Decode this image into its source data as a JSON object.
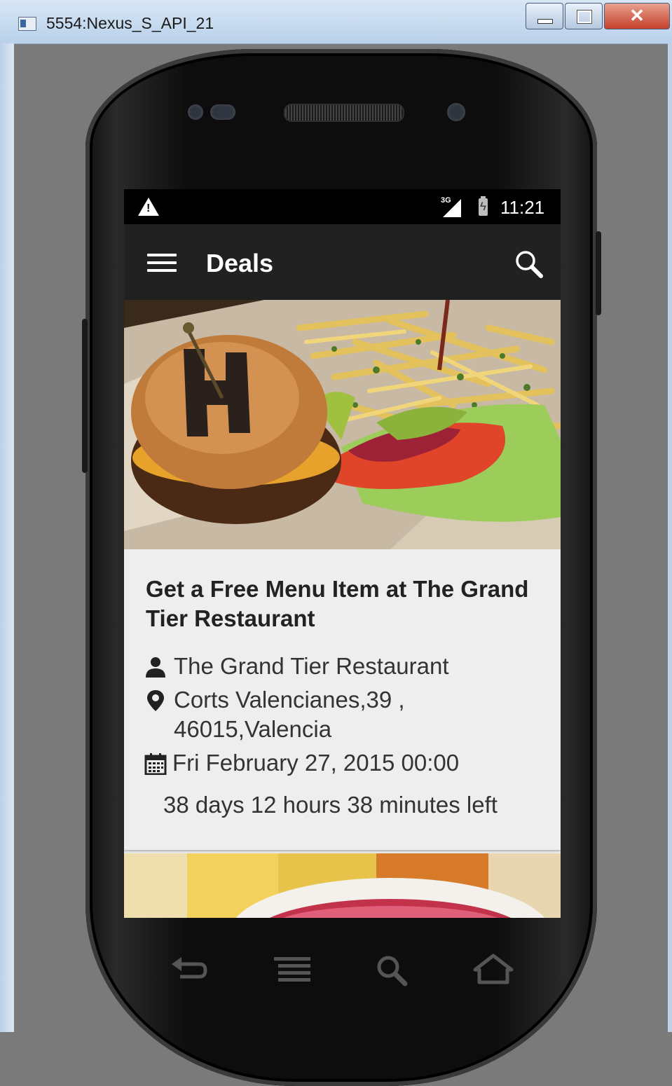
{
  "window": {
    "title": "5554:Nexus_S_API_21",
    "close_glyph": "✕"
  },
  "status_bar": {
    "network": "3G",
    "time": "11:21",
    "warning_icon": "warning-icon",
    "warning_mark": "!"
  },
  "toolbar": {
    "title": "Deals",
    "menu_icon": "hamburger-icon",
    "search_icon": "search-icon"
  },
  "deal": {
    "title": "Get a Free Menu Item at The Grand Tier Restaurant",
    "restaurant": "The Grand Tier Restaurant",
    "address_line1": "Corts Valencianes,39 ,",
    "address_line2": "46015,Valencia",
    "date": "Fri February 27, 2015 00:00",
    "countdown": "38 days 12 hours 38 minutes left"
  },
  "navigation": [
    "back-icon",
    "recent-apps-icon",
    "search-icon",
    "home-icon"
  ]
}
